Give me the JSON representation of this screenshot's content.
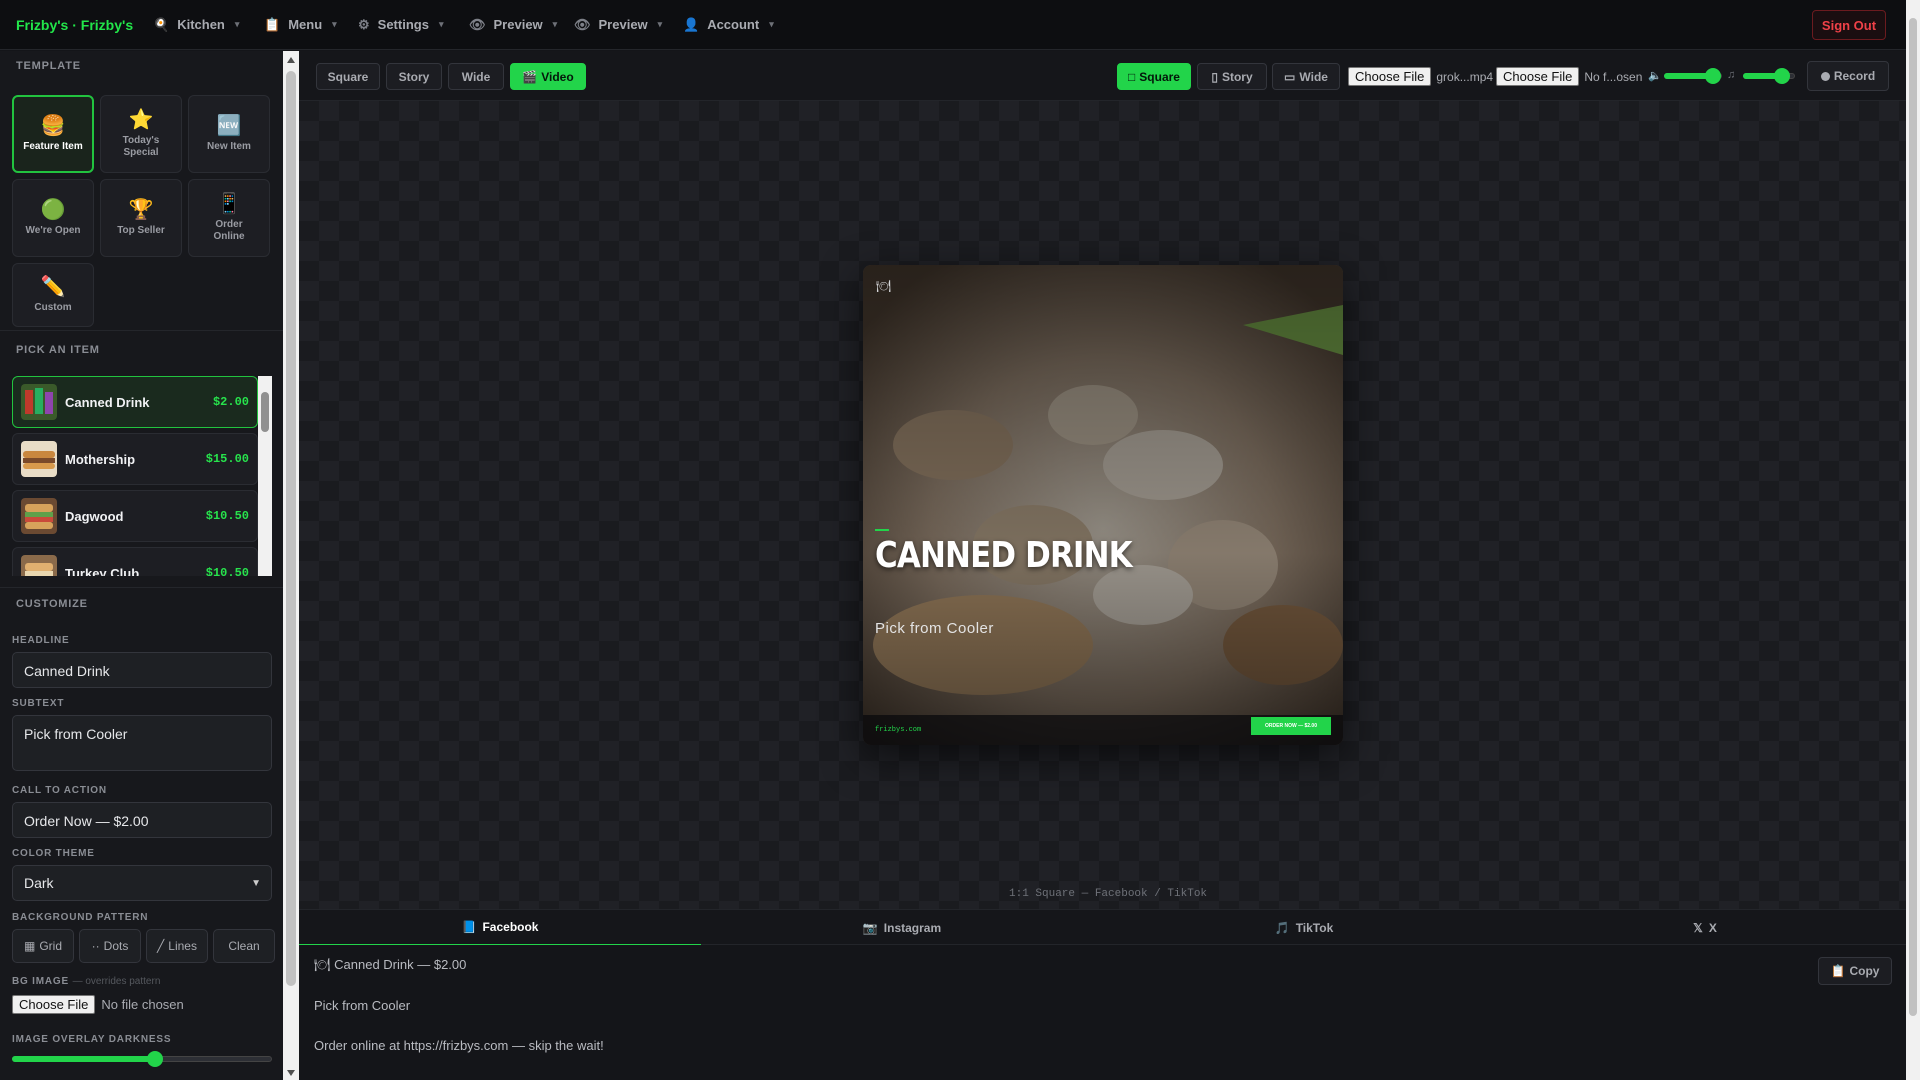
{
  "brand": "Frizby's · Frizby's",
  "nav": [
    {
      "label": "Kitchen",
      "icon": "🍳"
    },
    {
      "label": "Menu",
      "icon": "📋"
    },
    {
      "label": "Settings",
      "icon": "⚙"
    },
    {
      "label": "Preview",
      "icon": "👁"
    },
    {
      "label": "Preview",
      "icon": "👁"
    },
    {
      "label": "Account",
      "icon": "👤"
    }
  ],
  "sign_out": "Sign Out",
  "sidebar": {
    "template_title": "TEMPLATE",
    "templates": [
      {
        "label": "Feature Item",
        "icon": "🍔"
      },
      {
        "label": "Today's Special",
        "icon": "⭐"
      },
      {
        "label": "New Item",
        "icon": "🆕"
      },
      {
        "label": "We're Open",
        "icon": "🟢"
      },
      {
        "label": "Top Seller",
        "icon": "🏆"
      },
      {
        "label": "Order Online",
        "icon": "📱"
      },
      {
        "label": "Custom",
        "icon": "✏️"
      }
    ],
    "pick_title": "PICK AN ITEM",
    "items": [
      {
        "name": "Canned Drink",
        "price": "$2.00"
      },
      {
        "name": "Mothership",
        "price": "$15.00"
      },
      {
        "name": "Dagwood",
        "price": "$10.50"
      },
      {
        "name": "Turkey Club",
        "price": "$10.50"
      }
    ],
    "customize_title": "CUSTOMIZE",
    "headline_label": "HEADLINE",
    "headline": "Canned Drink",
    "subtext_label": "SUBTEXT",
    "subtext": "Pick from Cooler",
    "cta_label": "CALL TO ACTION",
    "cta": "Order Now — $2.00",
    "theme_label": "COLOR THEME",
    "theme": "Dark",
    "pattern_label": "BACKGROUND PATTERN",
    "patterns": [
      {
        "label": "Grid",
        "icon": "▦"
      },
      {
        "label": "Dots",
        "icon": "··"
      },
      {
        "label": "Lines",
        "icon": "╱"
      },
      {
        "label": "Clean",
        "icon": ""
      }
    ],
    "bg_image_label": "BG IMAGE",
    "bg_image_note": "— overrides pattern",
    "choose_file": "Choose File",
    "no_file": "No file chosen",
    "overlay_label": "IMAGE OVERLAY DARKNESS",
    "overlay_value": 0.55
  },
  "toolbar": {
    "left": [
      {
        "label": "Square"
      },
      {
        "label": "Story"
      },
      {
        "label": "Wide"
      },
      {
        "label": "Video",
        "icon": "🎬"
      }
    ],
    "right": [
      {
        "label": "Square",
        "icon": "□"
      },
      {
        "label": "Story",
        "icon": "▯"
      },
      {
        "label": "Wide",
        "icon": "▭"
      }
    ],
    "file1_btn": "Choose File",
    "file1_name": "grok...mp4",
    "file2_btn": "Choose File",
    "file2_name": "No f...osen",
    "volume_value": 0.85,
    "music_value": 0.75,
    "record": "Record"
  },
  "card": {
    "headline": "CANNED DRINK",
    "subtext": "Pick from Cooler",
    "site": "frizbys.com",
    "cta": "ORDER NOW — $2.00"
  },
  "caption": "1:1 Square — Facebook / TikTok",
  "social_tabs": [
    {
      "label": "Facebook",
      "icon": "📘"
    },
    {
      "label": "Instagram",
      "icon": "📷"
    },
    {
      "label": "TikTok",
      "icon": "🎵"
    },
    {
      "label": "X",
      "icon": "𝕏"
    }
  ],
  "post": {
    "line1": "Canned Drink — $2.00",
    "line1_icon": "🍽",
    "line2": "Pick from Cooler",
    "line3": "Order online at https://frizbys.com — skip the wait!"
  },
  "copy": "Copy",
  "colors": {
    "accent": "#22d44a",
    "danger": "#ef4148",
    "bg": "#141519"
  }
}
